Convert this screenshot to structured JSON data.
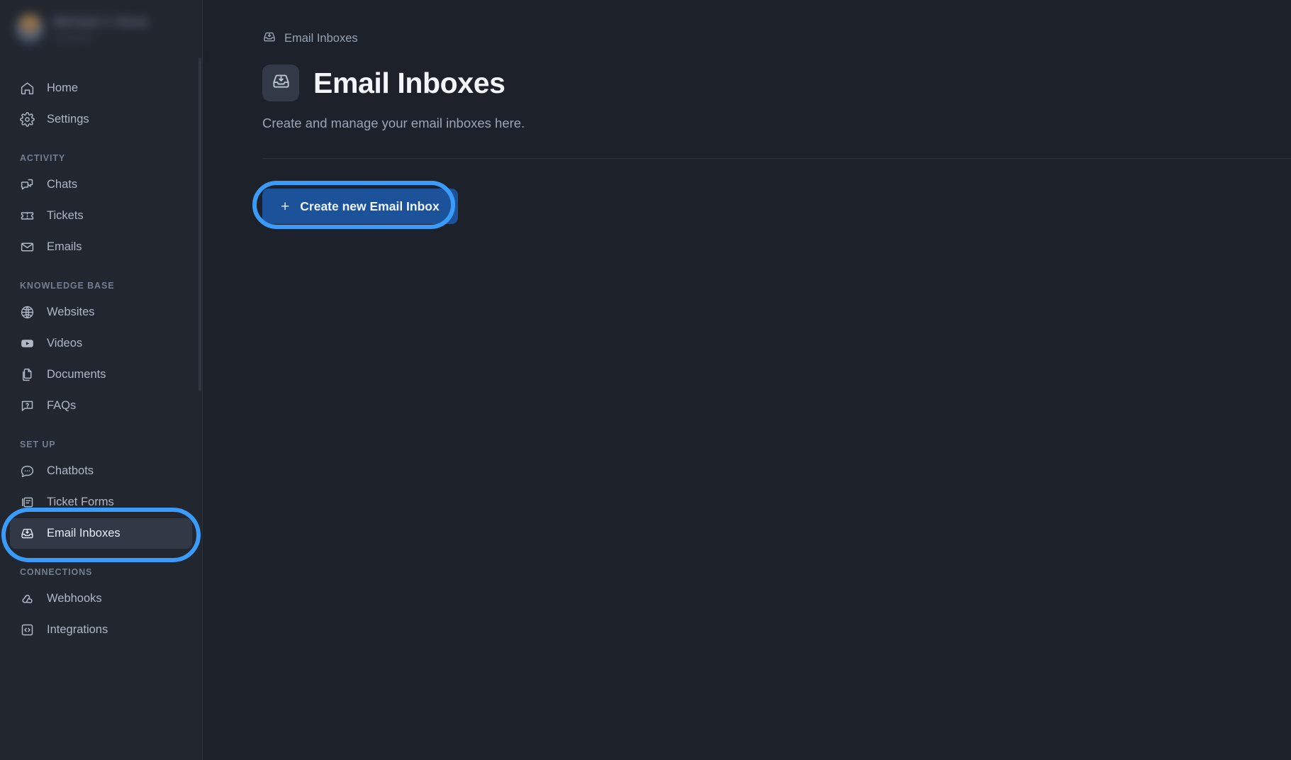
{
  "sidebar": {
    "profile": {
      "name": "Michael J. Dunn",
      "subtitle": "workspace"
    },
    "top_items": [
      {
        "label": "Home",
        "icon": "home-icon"
      },
      {
        "label": "Settings",
        "icon": "gear-icon"
      }
    ],
    "sections": [
      {
        "title": "ACTIVITY",
        "items": [
          {
            "label": "Chats",
            "icon": "chat-bubbles-icon"
          },
          {
            "label": "Tickets",
            "icon": "ticket-icon"
          },
          {
            "label": "Emails",
            "icon": "envelope-icon"
          }
        ]
      },
      {
        "title": "KNOWLEDGE BASE",
        "items": [
          {
            "label": "Websites",
            "icon": "globe-icon"
          },
          {
            "label": "Videos",
            "icon": "youtube-play-icon"
          },
          {
            "label": "Documents",
            "icon": "documents-icon"
          },
          {
            "label": "FAQs",
            "icon": "question-bubble-icon"
          }
        ]
      },
      {
        "title": "SET UP",
        "items": [
          {
            "label": "Chatbots",
            "icon": "chat-dots-icon"
          },
          {
            "label": "Ticket Forms",
            "icon": "form-icon"
          },
          {
            "label": "Email Inboxes",
            "icon": "inbox-download-icon",
            "active": true
          }
        ]
      },
      {
        "title": "CONNECTIONS",
        "items": [
          {
            "label": "Webhooks",
            "icon": "webhook-icon"
          },
          {
            "label": "Integrations",
            "icon": "code-brackets-icon"
          }
        ]
      }
    ]
  },
  "main": {
    "breadcrumb": {
      "label": "Email Inboxes",
      "icon": "inbox-download-icon"
    },
    "title": "Email Inboxes",
    "title_icon": "inbox-download-icon",
    "description": "Create and manage your email inboxes here.",
    "create_button": {
      "label": "Create new Email Inbox",
      "plus": "+"
    }
  },
  "colors": {
    "sidebar_bg": "#22262f",
    "main_bg": "#1d212a",
    "active_item_bg": "#323845",
    "button_blue": "#1b5299",
    "annotation_blue": "#3b9bfa",
    "text_primary": "#e8ecf2",
    "text_muted": "#9aa5b4"
  }
}
